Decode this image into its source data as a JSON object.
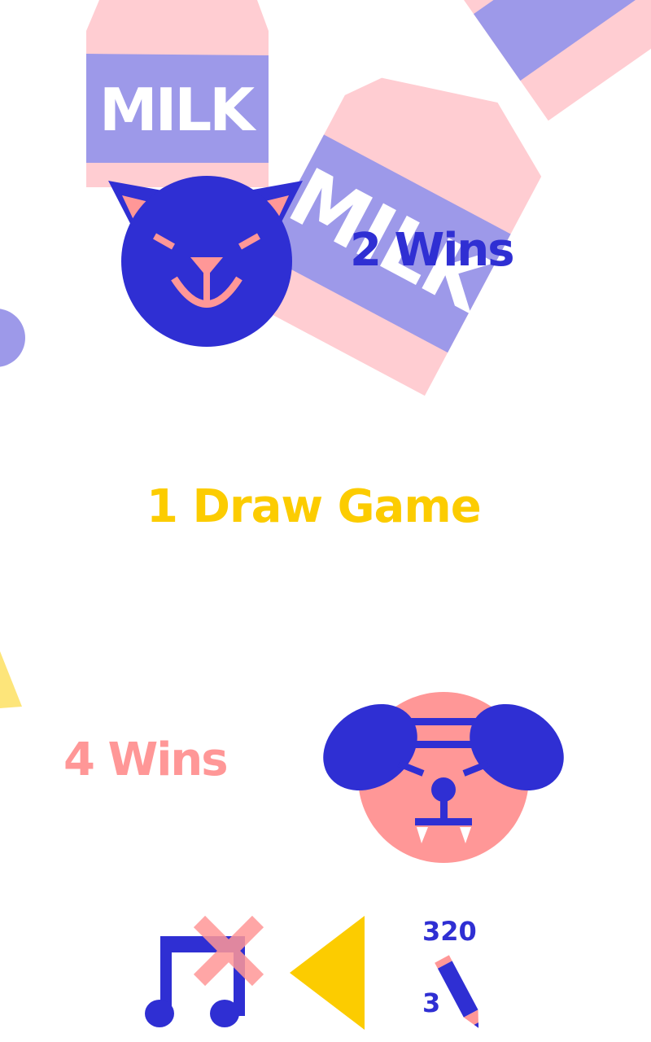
{
  "colors": {
    "background": "#ffffff",
    "cat_blue": "#2f2fd3",
    "milk_pink": "#ffcdd2",
    "milk_band": "#9d99e9",
    "dog_pink": "#ff9797",
    "draw_yellow": "#fccc00",
    "white": "#ffffff"
  },
  "background": {
    "milk_label_1": "MILK",
    "milk_label_2": "MILK"
  },
  "scoreboard": {
    "cat_wins": "2 Wins",
    "draw": "1 Draw Game",
    "dog_wins": "4 Wins"
  },
  "players": {
    "cat": {
      "icon": "cat-face-icon"
    },
    "dog": {
      "icon": "dog-face-icon"
    }
  },
  "controls": {
    "sound_icon": "music-note-muted-icon",
    "back_icon": "triangle-left-icon",
    "edit_icon": "pencil-icon",
    "counter_top": "320",
    "counter_bottom": "3"
  }
}
